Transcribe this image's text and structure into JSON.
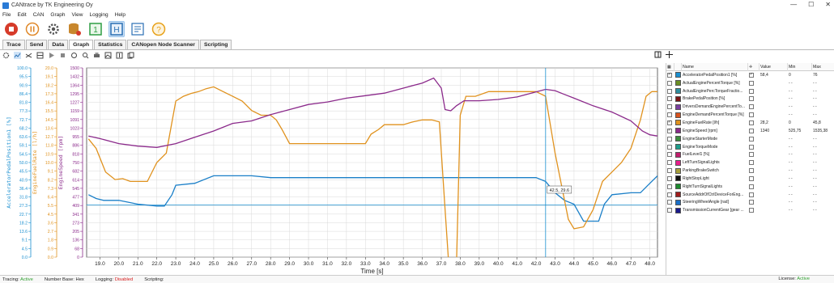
{
  "window": {
    "title": "CANtrace by TK Engineering Oy",
    "controls": [
      "—",
      "☐",
      "✕"
    ]
  },
  "menu": [
    "File",
    "Edit",
    "CAN",
    "Graph",
    "View",
    "Logging",
    "Help"
  ],
  "toolbar": {
    "buttons": [
      {
        "name": "stop-icon",
        "color": "#d63b2a"
      },
      {
        "name": "pause-icon",
        "color": "#e0892a"
      },
      {
        "name": "settings-icon",
        "color": "#555555"
      },
      {
        "name": "database-icon",
        "color": "#c8872d"
      },
      {
        "name": "channel-1-icon",
        "label": "1",
        "color": "#2f9e44"
      },
      {
        "name": "hex-icon",
        "label": "H",
        "color": "#2a6fb3"
      },
      {
        "name": "form-icon",
        "color": "#2a6fb3"
      },
      {
        "name": "help-icon",
        "label": "?",
        "color": "#e8a21b"
      }
    ]
  },
  "tabs": [
    "Trace",
    "Send",
    "Data",
    "Graph",
    "Statistics",
    "CANopen Node Scanner",
    "Scripting"
  ],
  "active_tab": "Graph",
  "chart_data": {
    "type": "line",
    "xlabel": "Time [s]",
    "x_ticks": [
      "19.0",
      "20.0",
      "21.0",
      "22.0",
      "23.0",
      "24.0",
      "25.0",
      "26.0",
      "27.0",
      "28.0",
      "29.0",
      "30.0",
      "31.0",
      "32.0",
      "33.0",
      "34.0",
      "35.0",
      "36.0",
      "37.0",
      "38.0",
      "39.0",
      "40.0",
      "41.0",
      "42.0",
      "43.0",
      "44.0",
      "45.0",
      "46.0",
      "47.0",
      "48.0"
    ],
    "xlim": [
      18.3,
      48.4
    ],
    "cursor_x": 42.5,
    "cursor_label": "42.5, 29.6",
    "accel_hline": 0.53,
    "axes": [
      {
        "label": "AcceleratorPedalPosition1 [%]",
        "color": "#1a8fd0",
        "ticks": [
          "100.0",
          "95.5",
          "90.9",
          "86.4",
          "81.8",
          "77.3",
          "72.7",
          "68.2",
          "63.6",
          "59.1",
          "54.5",
          "50.0",
          "45.5",
          "40.9",
          "36.4",
          "31.8",
          "27.3",
          "22.7",
          "18.2",
          "13.6",
          "9.1",
          "4.5",
          "0.0"
        ]
      },
      {
        "label": "EngineFuelRate [l/h]",
        "color": "#e0921e",
        "ticks": [
          "20.0",
          "19.1",
          "18.2",
          "17.3",
          "16.4",
          "15.5",
          "14.5",
          "13.6",
          "12.7",
          "11.8",
          "10.9",
          "10.0",
          "9.1",
          "8.2",
          "7.3",
          "6.4",
          "5.5",
          "4.5",
          "3.6",
          "2.7",
          "1.8",
          "0.9",
          "0.0"
        ]
      },
      {
        "label": "EngineSpeed [rpm]",
        "color": "#8b2a8b",
        "ticks": [
          "1500",
          "1432",
          "1364",
          "1295",
          "1227",
          "1159",
          "1091",
          "1023",
          "955",
          "886",
          "818",
          "750",
          "682",
          "614",
          "545",
          "477",
          "409",
          "341",
          "273",
          "205",
          "136",
          "68",
          "0"
        ]
      }
    ],
    "series": [
      {
        "name": "AcceleratorPedalPosition1 [%]",
        "color": "#1a7fc8",
        "x": [
          18.4,
          18.8,
          19.2,
          20,
          21,
          22,
          22.4,
          22.8,
          23,
          24,
          25,
          26,
          27,
          28,
          29,
          30,
          31,
          32,
          33,
          34,
          35,
          36,
          37,
          37.5,
          38,
          39,
          40,
          41,
          42,
          42.5,
          43,
          43.5,
          44,
          44.5,
          45,
          45.3,
          45.6,
          46,
          47,
          47.5,
          48,
          48.4
        ],
        "y": [
          33,
          31,
          30,
          30,
          28,
          27,
          27,
          33,
          38,
          39,
          43,
          43,
          43,
          42,
          42,
          42,
          42,
          42,
          42,
          42,
          42,
          42,
          42,
          42,
          42,
          42,
          42,
          42,
          42,
          40,
          34,
          30,
          28,
          19,
          19,
          19,
          28,
          33,
          34,
          34,
          39,
          43
        ]
      },
      {
        "name": "EngineFuelRate [l/h]",
        "color": "#e0921e",
        "x": [
          18.4,
          18.8,
          19.3,
          19.8,
          20.2,
          20.6,
          21,
          21.5,
          22,
          22.5,
          23,
          23.4,
          23.8,
          24.2,
          24.6,
          25,
          25.5,
          26,
          26.5,
          27,
          27.5,
          28,
          28.3,
          28.6,
          29,
          30,
          31,
          32,
          33,
          33.3,
          33.7,
          34,
          34.5,
          35,
          35.5,
          36,
          36.5,
          36.9,
          37.2,
          37.4,
          37.6,
          37.8,
          38,
          38.3,
          38.8,
          39.5,
          40,
          40.5,
          41,
          41.5,
          42,
          42.5,
          43,
          43.5,
          43.7,
          44,
          44.5,
          45,
          45.5,
          46,
          46.5,
          47,
          47.5,
          47.8,
          48.1,
          48.4
        ],
        "y": [
          12.5,
          11.5,
          9.0,
          8.2,
          8.3,
          8.0,
          8.0,
          8.0,
          10,
          11,
          16.5,
          17,
          17.3,
          17.5,
          17.8,
          18,
          17.5,
          17,
          16.5,
          15.5,
          15,
          15,
          14.5,
          13.5,
          12,
          12,
          12,
          12,
          12,
          13,
          13.5,
          14,
          14,
          14,
          14.3,
          14.5,
          14.5,
          14.3,
          5,
          -1,
          -1,
          -1,
          15,
          17,
          17,
          17.5,
          17.5,
          17.5,
          17.5,
          17.5,
          17.5,
          17,
          11,
          6,
          4,
          3,
          3.2,
          5,
          8,
          9,
          10,
          11.5,
          14.5,
          17,
          17.5,
          17.5
        ]
      },
      {
        "name": "EngineSpeed [rpm]",
        "color": "#8b2a8b",
        "x": [
          18.4,
          19,
          20,
          21,
          22,
          23,
          24,
          25,
          26,
          27,
          28,
          29,
          30,
          31,
          32,
          33,
          34,
          35,
          36,
          36.6,
          37,
          37.2,
          37.5,
          37.8,
          38.2,
          39,
          40,
          41,
          42,
          42.5,
          43,
          43.5,
          44,
          45,
          46,
          47,
          47.6,
          48,
          48.4
        ],
        "y": [
          960,
          940,
          900,
          880,
          870,
          900,
          950,
          1000,
          1060,
          1080,
          1130,
          1170,
          1210,
          1230,
          1260,
          1280,
          1300,
          1340,
          1380,
          1420,
          1340,
          1170,
          1160,
          1200,
          1240,
          1240,
          1250,
          1270,
          1310,
          1330,
          1320,
          1290,
          1260,
          1200,
          1150,
          1080,
          1000,
          970,
          960
        ]
      }
    ]
  },
  "signals": {
    "headers": {
      "name": "Name",
      "value": "Value",
      "min": "Min",
      "max": "Max"
    },
    "rows": [
      {
        "checked": true,
        "color": "#1a8fd0",
        "name": "AcceleratorPedalPosition1 [%]",
        "vis": true,
        "value": "58,4",
        "min": "0",
        "max": "76"
      },
      {
        "checked": false,
        "color": "#6b8e23",
        "name": "ActualEnginePercentTorque [%]",
        "vis": false,
        "value": "",
        "min": "- -",
        "max": "- -"
      },
      {
        "checked": false,
        "color": "#2f8fa0",
        "name": "ActualEnginePercTorqueFractio...",
        "vis": false,
        "value": "",
        "min": "- -",
        "max": "- -"
      },
      {
        "checked": false,
        "color": "#7a1414",
        "name": "BrakePedalPosition [%]",
        "vis": false,
        "value": "",
        "min": "- -",
        "max": "- -"
      },
      {
        "checked": false,
        "color": "#7b3fa0",
        "name": "DriversDemandEnginePercentTo...",
        "vis": false,
        "value": "",
        "min": "- -",
        "max": "- -"
      },
      {
        "checked": false,
        "color": "#d9531e",
        "name": "EngineDemandPercentTorque [%]",
        "vis": false,
        "value": "",
        "min": "- -",
        "max": "- -"
      },
      {
        "checked": true,
        "color": "#e0921e",
        "name": "EngineFuelRate [l/h]",
        "vis": false,
        "value": "28,2",
        "min": "0",
        "max": "45,8"
      },
      {
        "checked": true,
        "color": "#8b2a8b",
        "name": "EngineSpeed [rpm]",
        "vis": false,
        "value": "1340",
        "min": "525,75",
        "max": "1535,38"
      },
      {
        "checked": false,
        "color": "#3c8c3c",
        "name": "EngineStarterMode",
        "vis": false,
        "value": "",
        "min": "- -",
        "max": "- -"
      },
      {
        "checked": false,
        "color": "#1e9d8b",
        "name": "EngineTorqueMode",
        "vis": false,
        "value": "",
        "min": "- -",
        "max": "- -"
      },
      {
        "checked": false,
        "color": "#c21f6e",
        "name": "FuelLevel1 [%]",
        "vis": false,
        "value": "",
        "min": "- -",
        "max": "- -"
      },
      {
        "checked": false,
        "color": "#e91e8c",
        "name": "LeftTurnSignalLights",
        "vis": false,
        "value": "",
        "min": "- -",
        "max": "- -"
      },
      {
        "checked": false,
        "color": "#a8a03a",
        "name": "ParkingBrakeSwitch",
        "vis": false,
        "value": "",
        "min": "- -",
        "max": "- -"
      },
      {
        "checked": false,
        "color": "#111111",
        "name": "RightStopLight",
        "vis": false,
        "value": "",
        "min": "- -",
        "max": "- -"
      },
      {
        "checked": false,
        "color": "#1c8a2e",
        "name": "RightTurnSignalLights",
        "vis": false,
        "value": "",
        "min": "- -",
        "max": "- -"
      },
      {
        "checked": false,
        "color": "#a01d1d",
        "name": "SourceAddrOfCtrlDeviceForEng...",
        "vis": false,
        "value": "",
        "min": "- -",
        "max": "- -"
      },
      {
        "checked": false,
        "color": "#1a6fc8",
        "name": "SteeringWheelAngle [rad]",
        "vis": false,
        "value": "",
        "min": "- -",
        "max": "- -"
      },
      {
        "checked": false,
        "color": "#1a1a8c",
        "name": "TransmissionCurrentGear [gear ...",
        "vis": false,
        "value": "",
        "min": "- -",
        "max": "- -"
      }
    ]
  },
  "status": {
    "tracing_label": "Tracing:",
    "tracing_value": "Active",
    "numbase_label": "Number Base:",
    "numbase_value": "Hex",
    "logging_label": "Logging:",
    "logging_value": "Disabled",
    "scripting_label": "Scripting:",
    "license_label": "License:",
    "license_value": "Active"
  }
}
